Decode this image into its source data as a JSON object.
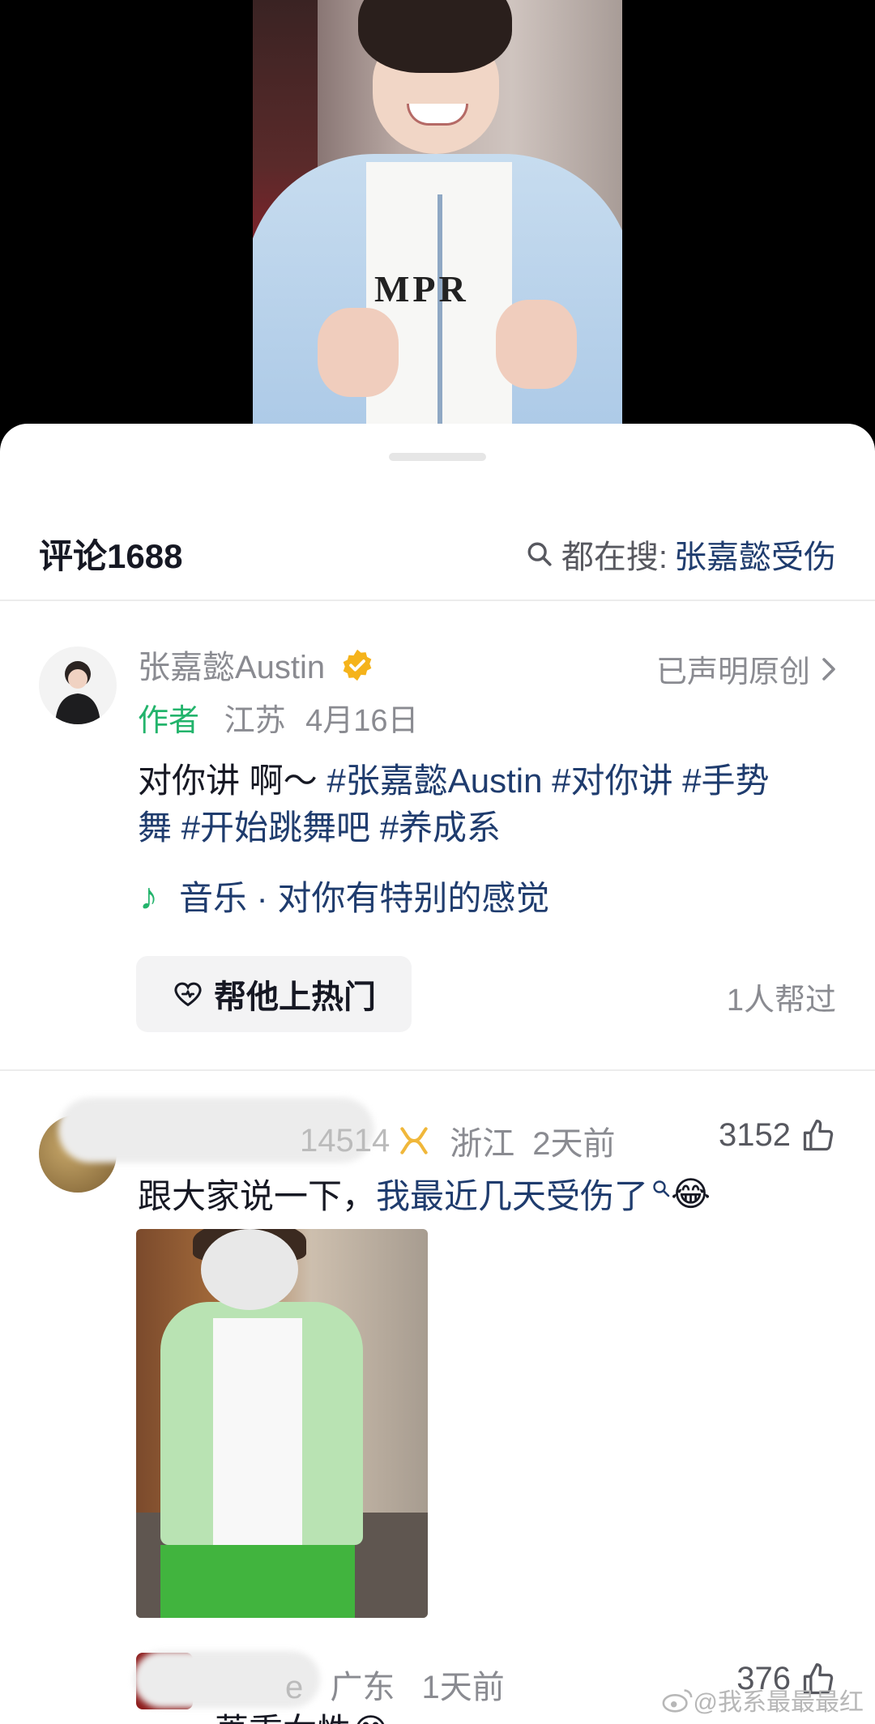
{
  "comments_header": {
    "title": "评论1688",
    "search_prefix": "都在搜:",
    "search_keyword": "张嘉懿受伤"
  },
  "post": {
    "author_name": "张嘉懿Austin",
    "author_tag": "作者",
    "location": "江苏",
    "date": "4月16日",
    "original_declared": "已声明原创",
    "caption_plain": "对你讲 啊～ ",
    "hashtags_line1": "#张嘉懿Austin #对你讲 #手势",
    "hashtags_line2": "舞 #开始跳舞吧 #养成系",
    "music": "音乐 · 对你有特别的感觉",
    "boost_label": "帮他上热门",
    "boost_count": "1人帮过"
  },
  "comments": [
    {
      "name_visible": "14514",
      "location": "浙江",
      "time": "2天前",
      "likes": "3152",
      "text_plain": "跟大家说一下，",
      "text_link": "我最近几天受伤了",
      "emoji": "😂"
    },
    {
      "name_visible": "e",
      "location": "广东",
      "time": "1天前",
      "likes": "376",
      "text_partial": "萧重女性😂"
    }
  ],
  "watermark": "@我系最最最红"
}
